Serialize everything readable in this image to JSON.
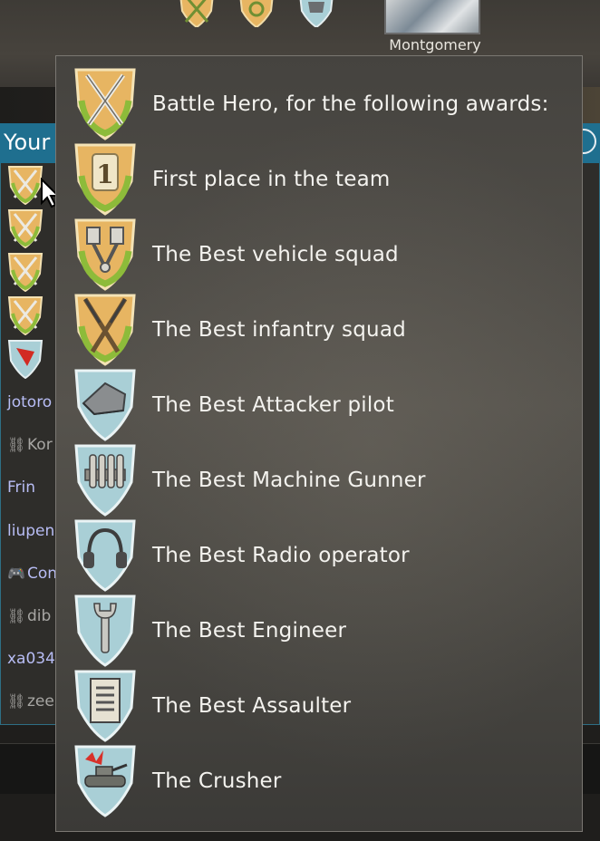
{
  "profile": {
    "name": "Montgomery"
  },
  "panel": {
    "title": "Your",
    "rows": [
      {
        "text": "jotoro",
        "style": "blue"
      },
      {
        "text": "Kor",
        "style": "grey",
        "icon": "link-icon"
      },
      {
        "text": "Frin",
        "style": "blue"
      },
      {
        "text": "liupen",
        "style": "blue"
      },
      {
        "text": "Con",
        "style": "blue",
        "icon": "gamepad-icon"
      },
      {
        "text": "dib",
        "style": "grey",
        "icon": "link-icon"
      },
      {
        "text": "xa034",
        "style": "blue"
      },
      {
        "text": "zee",
        "style": "grey",
        "icon": "link-icon"
      }
    ]
  },
  "tooltip": {
    "awards": [
      {
        "label": "Battle Hero, for the following awards:",
        "icon": "crossed-swords-icon"
      },
      {
        "label": "First place in the team",
        "icon": "first-place-icon"
      },
      {
        "label": "The Best vehicle squad",
        "icon": "pistons-icon"
      },
      {
        "label": "The Best infantry squad",
        "icon": "crossed-rifles-icon"
      },
      {
        "label": "The Best Attacker pilot",
        "icon": "pilot-cap-icon"
      },
      {
        "label": "The Best Machine Gunner",
        "icon": "ammo-belt-icon"
      },
      {
        "label": "The Best Radio operator",
        "icon": "headphones-icon"
      },
      {
        "label": "The Best Engineer",
        "icon": "wrench-icon"
      },
      {
        "label": "The Best Assaulter",
        "icon": "clipboard-icon"
      },
      {
        "label": "The Crusher",
        "icon": "tank-icon"
      }
    ]
  },
  "colors": {
    "shield_gold": "#e7b562",
    "shield_green": "#8dbb3a",
    "shield_blue": "#a9cfd6",
    "header_blue": "#1f6f8f",
    "link_blue": "#b8bdf5"
  }
}
